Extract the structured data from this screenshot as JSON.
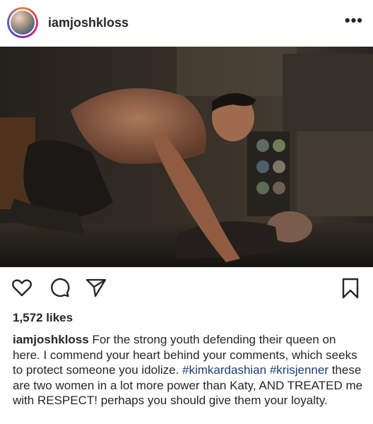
{
  "header": {
    "username": "iamjoshkloss",
    "more_label": "•••"
  },
  "photo": {
    "icon": "photo-scene"
  },
  "actions": {
    "like_icon": "heart-icon",
    "comment_icon": "comment-icon",
    "share_icon": "send-icon",
    "save_icon": "bookmark-icon"
  },
  "likes": "1,572 likes",
  "caption": {
    "username": "iamjoshkloss",
    "text_1": " For the strong youth defending their queen on here. I commend your heart behind your comments, which seeks to protect someone you idolize. ",
    "hashtag_1": "#kimkardashian",
    "space": " ",
    "hashtag_2": "#krisjenner",
    "text_2": "  these are two women in a lot more power than Katy, AND TREATED me with RESPECT! perhaps you should give them your loyalty."
  },
  "colors": {
    "hashtag": "#1c3d7a",
    "text": "#262626"
  }
}
